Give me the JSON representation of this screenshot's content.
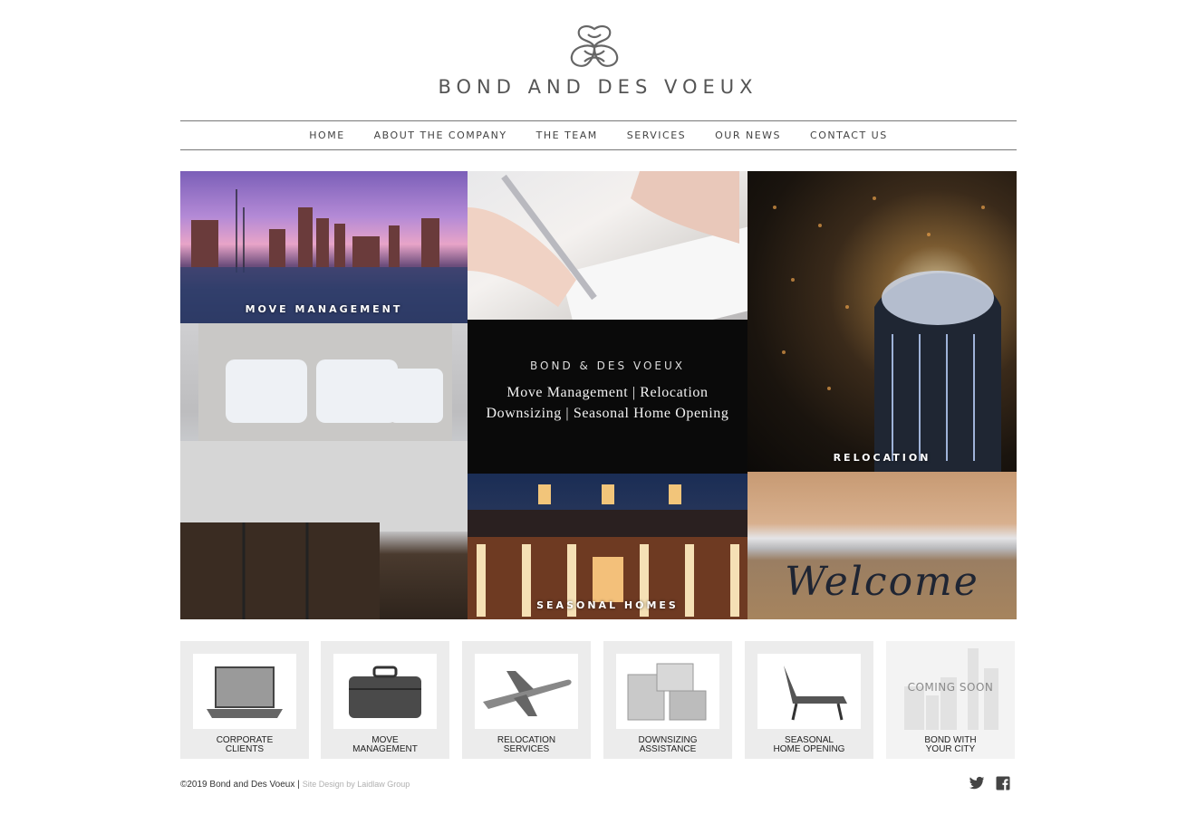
{
  "brand": {
    "name": "BOND AND DES VOEUX"
  },
  "nav": {
    "items": [
      "HOME",
      "ABOUT THE COMPANY",
      "THE TEAM",
      "SERVICES",
      "OUR NEWS",
      "CONTACT US"
    ]
  },
  "mosaic": {
    "move_management": "MOVE MANAGEMENT",
    "relocation": "RELOCATION",
    "seasonal_homes": "SEASONAL HOMES",
    "banner": {
      "small": "BOND & DES VOEUX",
      "line1": "Move Management | Relocation",
      "line2": "Downsizing | Seasonal Home Opening"
    },
    "welcome_mat": "Welcome"
  },
  "cards": [
    {
      "line1": "CORPORATE",
      "line2": "CLIENTS",
      "icon": "laptop-icon"
    },
    {
      "line1": "MOVE",
      "line2": "MANAGEMENT",
      "icon": "suitcase-icon"
    },
    {
      "line1": "RELOCATION",
      "line2": "SERVICES",
      "icon": "airplane-icon"
    },
    {
      "line1": "DOWNSIZING",
      "line2": "ASSISTANCE",
      "icon": "boxes-icon"
    },
    {
      "line1": "SEASONAL",
      "line2": "HOME OPENING",
      "icon": "lounge-chair-icon"
    },
    {
      "line1": "BOND WITH",
      "line2": "YOUR CITY",
      "overlay": "COMING SOON",
      "icon": "city-skyline-icon"
    }
  ],
  "footer": {
    "copyright": "©2019 Bond and Des Voeux |",
    "credit": "Site Design by Laidlaw Group"
  },
  "social": [
    "twitter-icon",
    "facebook-icon"
  ]
}
